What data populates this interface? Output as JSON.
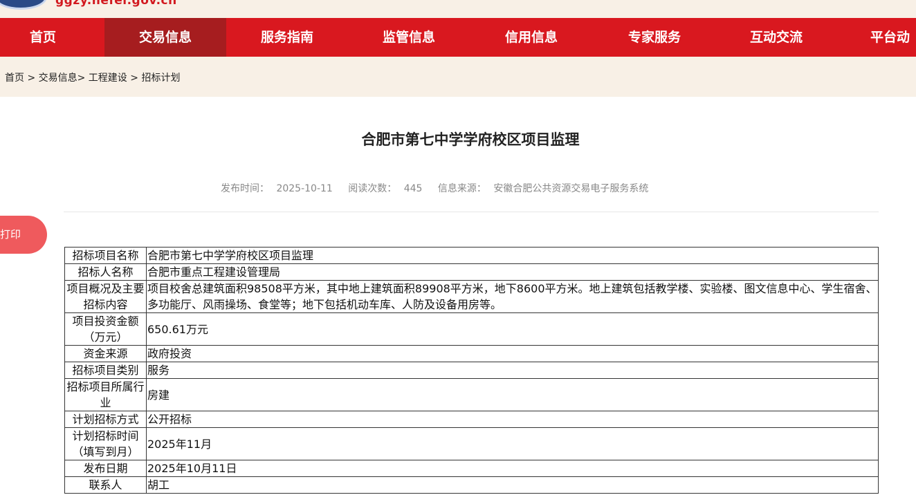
{
  "header": {
    "site_url": "ggzy.hefei.gov.cn"
  },
  "nav": {
    "items": [
      "首页",
      "交易信息",
      "服务指南",
      "监管信息",
      "信用信息",
      "专家服务",
      "互动交流",
      "平台动"
    ]
  },
  "breadcrumb": "首页 > 交易信息> 工程建设 > 招标计划",
  "article": {
    "title": "合肥市第七中学学府校区项目监理",
    "publish_label": "发布时间：",
    "publish_value": "2025-10-11",
    "views_label": "阅读次数：",
    "views_value": "445",
    "source_label": "信息来源：",
    "source_value": "安徽合肥公共资源交易电子服务系统"
  },
  "print_label": "打印",
  "table": {
    "rows": [
      {
        "label": "招标项目名称",
        "value": "合肥市第七中学学府校区项目监理"
      },
      {
        "label": "招标人名称",
        "value": "合肥市重点工程建设管理局"
      },
      {
        "label": "项目概况及主要招标内容",
        "value": "项目校舍总建筑面积98508平方米，其中地上建筑面积89908平方米，地下8600平方米。地上建筑包括教学楼、实验楼、图文信息中心、学生宿舍、多功能厅、风雨操场、食堂等；地下包括机动车库、人防及设备用房等。"
      },
      {
        "label": "项目投资金额（万元）",
        "value": "650.61万元"
      },
      {
        "label": "资金来源",
        "value": "政府投资"
      },
      {
        "label": "招标项目类别",
        "value": "服务"
      },
      {
        "label": "招标项目所属行业",
        "value": "房建"
      },
      {
        "label": "计划招标方式",
        "value": "公开招标"
      },
      {
        "label": "计划招标时间（填写到月）",
        "value": "2025年11月"
      },
      {
        "label": "发布日期",
        "value": "2025年10月11日"
      },
      {
        "label": "联系人",
        "value": "胡工"
      }
    ]
  }
}
